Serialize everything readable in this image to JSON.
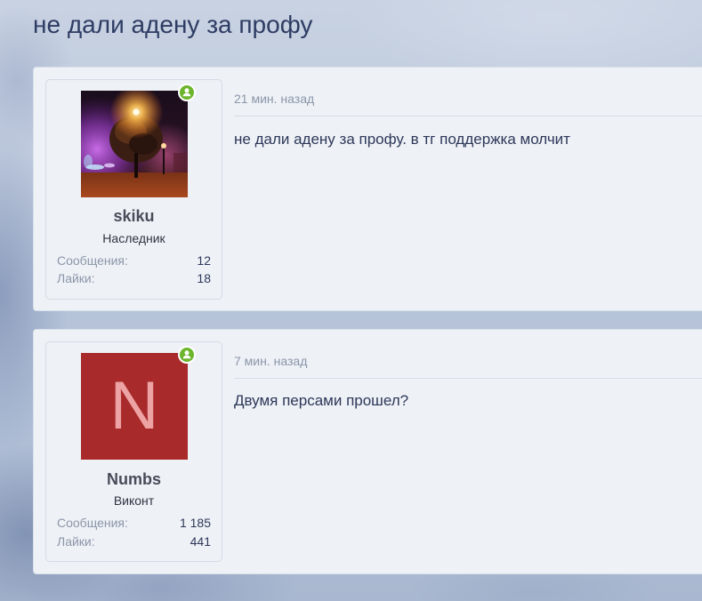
{
  "thread": {
    "title": "не дали адену за профу"
  },
  "posts": [
    {
      "user": {
        "name": "skiku",
        "title": "Наследник",
        "online": true,
        "stats": {
          "messages_label": "Сообщения:",
          "messages": "12",
          "likes_label": "Лайки:",
          "likes": "18"
        }
      },
      "date": "21 мин. назад",
      "message": "не дали адену за профу. в тг поддержка молчит"
    },
    {
      "user": {
        "name": "Numbs",
        "title": "Виконт",
        "online": true,
        "avatar_letter": "N",
        "avatar_color": "#a82a2a",
        "stats": {
          "messages_label": "Сообщения:",
          "messages": "1 185",
          "likes_label": "Лайки:",
          "likes": "441"
        }
      },
      "date": "7 мин. назад",
      "message": "Двумя персами прошел?"
    }
  ],
  "icons": {
    "online": "online-status-icon"
  },
  "colors": {
    "title": "#2e3c63",
    "online": "#6cb52d",
    "card_bg": "#eef1f6",
    "muted": "#8c96a9",
    "text": "#2d3859"
  }
}
